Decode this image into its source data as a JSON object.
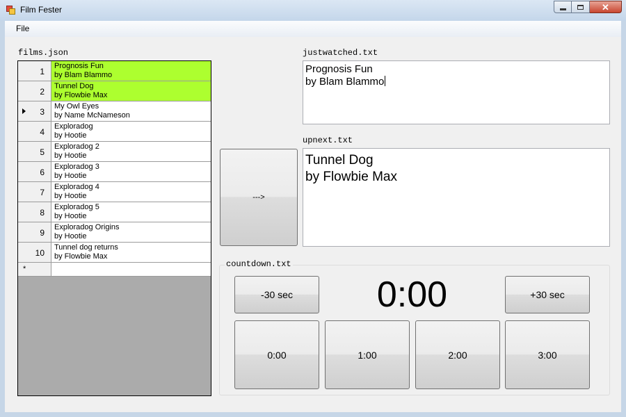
{
  "window": {
    "title": "Film Fester",
    "icon": "app-icon",
    "controls": {
      "minimize": "minimize-icon",
      "maximize": "maximize-icon",
      "close": "close-icon"
    }
  },
  "menu": {
    "file": "File"
  },
  "films_label": "films.json",
  "films": [
    {
      "num": "1",
      "title": "Prognosis Fun",
      "author": "by Blam Blammo",
      "highlighted": true,
      "current": false
    },
    {
      "num": "2",
      "title": "Tunnel Dog",
      "author": "by Flowbie Max",
      "highlighted": true,
      "current": false
    },
    {
      "num": "3",
      "title": "My Owl Eyes",
      "author": "by Name McNameson",
      "highlighted": false,
      "current": true
    },
    {
      "num": "4",
      "title": "Exploradog",
      "author": "by Hootie",
      "highlighted": false,
      "current": false
    },
    {
      "num": "5",
      "title": "Exploradog 2",
      "author": "by Hootie",
      "highlighted": false,
      "current": false
    },
    {
      "num": "6",
      "title": "Exploradog 3",
      "author": "by Hootie",
      "highlighted": false,
      "current": false
    },
    {
      "num": "7",
      "title": "Exploradog 4",
      "author": "by Hootie",
      "highlighted": false,
      "current": false
    },
    {
      "num": "8",
      "title": "Exploradog 5",
      "author": "by Hootie",
      "highlighted": false,
      "current": false
    },
    {
      "num": "9",
      "title": "Exploradog Origins",
      "author": "by Hootie",
      "highlighted": false,
      "current": false
    },
    {
      "num": "10",
      "title": "Tunnel dog returns",
      "author": "by Flowbie Max",
      "highlighted": false,
      "current": false
    }
  ],
  "new_row_marker": "*",
  "just_watched": {
    "label": "justwatched.txt",
    "line1": "Prognosis Fun",
    "line2": "by Blam Blammo"
  },
  "up_next": {
    "label": "upnext.txt",
    "line1": "Tunnel Dog",
    "line2": "by Flowbie Max"
  },
  "advance_button": "--->",
  "countdown": {
    "label": "countdown.txt",
    "time": "0:00",
    "minus_label": "-30 sec",
    "plus_label": "+30 sec",
    "presets": [
      "0:00",
      "1:00",
      "2:00",
      "3:00"
    ]
  },
  "colors": {
    "highlight": "#adff2f",
    "grid_background": "#ababab",
    "form_background": "#f0f0f0"
  }
}
